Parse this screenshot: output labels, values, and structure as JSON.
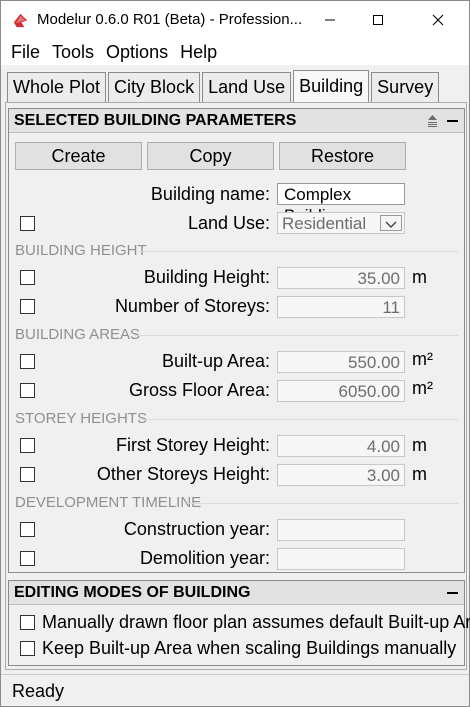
{
  "window": {
    "title": "Modelur 0.6.0 R01 (Beta) - Profession...",
    "minimize_icon": "minimize-icon",
    "maximize_icon": "maximize-icon",
    "close_icon": "close-icon"
  },
  "menu": {
    "items": [
      "File",
      "Tools",
      "Options",
      "Help"
    ]
  },
  "tabs": [
    {
      "label": "Whole Plot",
      "active": false
    },
    {
      "label": "City Block",
      "active": false
    },
    {
      "label": "Land Use",
      "active": false
    },
    {
      "label": "Building",
      "active": true
    },
    {
      "label": "Survey",
      "active": false
    }
  ],
  "params": {
    "header": "SELECTED BUILDING PARAMETERS",
    "buttons": {
      "create": "Create",
      "copy": "Copy",
      "restore": "Restore"
    },
    "building_name": {
      "label": "Building name:",
      "value": "Complex Building"
    },
    "land_use": {
      "label": "Land Use:",
      "value": "Residential",
      "checked": false
    },
    "groups": {
      "height": "BUILDING HEIGHT",
      "areas": "BUILDING AREAS",
      "storeys": "STOREY HEIGHTS",
      "timeline": "DEVELOPMENT TIMELINE"
    },
    "building_height": {
      "label": "Building Height:",
      "value": "35.00",
      "unit": "m"
    },
    "num_storeys": {
      "label": "Number of Storeys:",
      "value": "11"
    },
    "builtup_area": {
      "label": "Built-up Area:",
      "value": "550.00",
      "unit": "m²"
    },
    "gross_floor_area": {
      "label": "Gross Floor Area:",
      "value": "6050.00",
      "unit": "m²"
    },
    "first_storey": {
      "label": "First Storey Height:",
      "value": "4.00",
      "unit": "m"
    },
    "other_storeys": {
      "label": "Other Storeys Height:",
      "value": "3.00",
      "unit": "m"
    },
    "construction_year": {
      "label": "Construction year:",
      "value": ""
    },
    "demolition_year": {
      "label": "Demolition year:",
      "value": ""
    }
  },
  "editing": {
    "header": "EDITING MODES OF BUILDING",
    "options": [
      "Manually drawn floor plan assumes default Built-up Area",
      "Keep Built-up Area when scaling Buildings manually"
    ]
  },
  "status": {
    "text": "Ready"
  },
  "colors": {
    "accent_red": "#d32f2f",
    "header_bg": "#e2e2e2",
    "group_text": "#8f8f8f"
  }
}
